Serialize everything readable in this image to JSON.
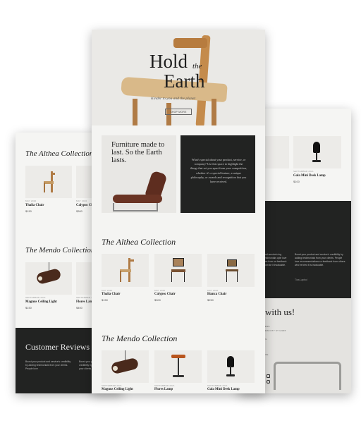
{
  "hero": {
    "title_hold": "Hold",
    "title_the": "the",
    "title_earth": "Earth",
    "subtitle": "Kinder to you and the planet",
    "button_label": "SHOP MORE"
  },
  "intro": {
    "heading": "Furniture made to last. So the Earth lasts.",
    "body": "What's special about your product, service, or company? Use this space to highlight the things that set you apart from your competition, whether it's a special feature, a unique philosophy, or awards and recognition that you have received."
  },
  "althea": {
    "title": "The Althea Collection",
    "products": [
      {
        "tag": "MAY 2020",
        "name": "Thalia Chair",
        "price": "$150"
      },
      {
        "tag": "MAY 2020",
        "name": "Calypso Chair",
        "price": "$300"
      },
      {
        "tag": "MAY 2020",
        "name": "Bianca Chair",
        "price": "$250"
      }
    ]
  },
  "mendo": {
    "title": "The Mendo Collection",
    "products": [
      {
        "tag": "SEPTEMBER 2021",
        "name": "Magnus Ceiling Light",
        "price": "$100"
      },
      {
        "tag": "SEPTEMBER 2021",
        "name": "Flores Lamp",
        "price": "$400"
      },
      {
        "tag": "SEPTEMBER 2021",
        "name": "Gala Mini Desk Lamp",
        "price": "$100"
      }
    ]
  },
  "left_page": {
    "althea_title": "The Althea Collection",
    "mendo_title": "The Mendo Collection",
    "products_top": [
      {
        "tag": "MAY 2020",
        "name": "Thalia Chair",
        "price": "$150"
      },
      {
        "tag": "MAY 2020",
        "name": "Calypso Chair",
        "price": "$300"
      }
    ],
    "products_bottom": [
      {
        "tag": "SEPTEMBER 2021",
        "name": "Magnus Ceiling Light",
        "price": "$150"
      },
      {
        "tag": "SEPTEMBER 2021",
        "name": "Flores Lamp",
        "price": "$400"
      }
    ],
    "reviews_title": "Customer Reviews",
    "review_1": "Boost your product and service's credibility by adding testimonials from your clients. People love",
    "review_2": "Boost your product and service's credibility by adding testimonials from your clients. People love"
  },
  "right_page": {
    "products_top": [
      {
        "tag": "",
        "name": "",
        "price": ""
      },
      {
        "tag": "SEPTEMBER 2021",
        "name": "Gala Mini Desk Lamp",
        "price": "$100"
      }
    ],
    "review_left": "and service's ing testimonials ople love ons from us feedback from ke it invaluable.",
    "review_right": "Boost your product and service's credibility by adding testimonials from your clients. People love recommendations so feedback from others who've tried it is invaluable.",
    "reviewer": "Tina Lapbol",
    "contact_title": "with us!",
    "contact_lines": [
      "ESS",
      "ew City ST 12345",
      "IL",
      "UE"
    ]
  },
  "colors": {
    "dark": "#222322",
    "page_bg": "#f5f5f3",
    "thumb_bg": "#ecebe8"
  }
}
